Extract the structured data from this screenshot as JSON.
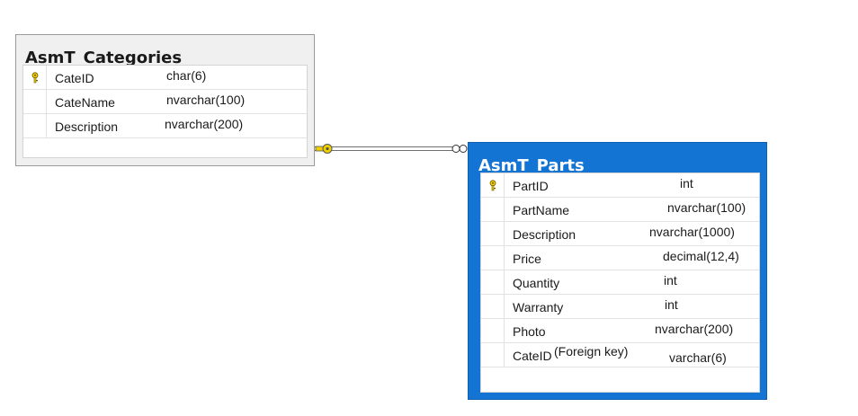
{
  "tables": {
    "categories": {
      "title": "AsmT_Categories",
      "columns": [
        {
          "name": "CateID",
          "type": "char(6)",
          "primary_key": true
        },
        {
          "name": "CateName",
          "type": "nvarchar(100)",
          "primary_key": false
        },
        {
          "name": "Description",
          "type": "nvarchar(200)",
          "primary_key": false
        }
      ]
    },
    "parts": {
      "title": "AsmT_Parts",
      "columns": [
        {
          "name": "PartID",
          "type": "int",
          "primary_key": true
        },
        {
          "name": "PartName",
          "type": "nvarchar(100)",
          "primary_key": false
        },
        {
          "name": "Description",
          "type": "nvarchar(1000)",
          "primary_key": false
        },
        {
          "name": "Price",
          "type": "decimal(12,4)",
          "primary_key": false
        },
        {
          "name": "Quantity",
          "type": "int",
          "primary_key": false
        },
        {
          "name": "Warranty",
          "type": "int",
          "primary_key": false
        },
        {
          "name": "Photo",
          "type": "nvarchar(200)",
          "primary_key": false
        },
        {
          "name": "CateID",
          "type": "varchar(6)",
          "primary_key": false
        }
      ],
      "note": "(Foreign key)"
    }
  },
  "relationship": {
    "from": "AsmT_Categories",
    "to": "AsmT_Parts",
    "from_end": "key-icon",
    "to_end": "infinity-icon"
  },
  "colors": {
    "selected_table": "#1474d4",
    "table_bg": "#f0f0f0",
    "key_icon": "#f0d000"
  }
}
